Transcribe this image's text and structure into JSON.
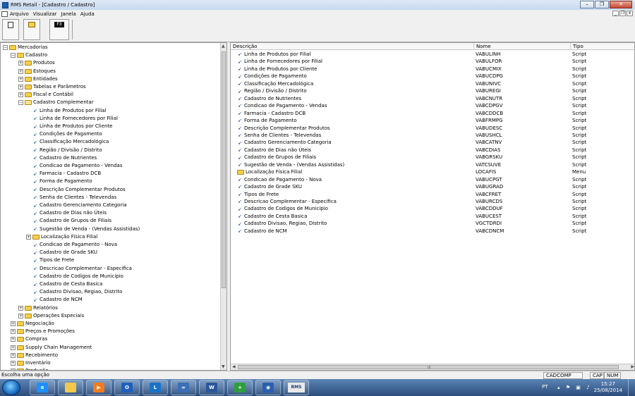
{
  "window": {
    "title": "RMS Retail - [Cadastro / Cadastro]",
    "minimize_glyph": "–",
    "restore_glyph": "❐",
    "close_glyph": "✕"
  },
  "menubar": {
    "items": [
      "Arquivo",
      "Visualizar",
      "Janela",
      "Ajuda"
    ],
    "mdi_min": "_",
    "mdi_restore": "❐",
    "mdi_close": "x"
  },
  "toolbar": {
    "new_icon": "document-icon",
    "open_icon": "folder-open-icon",
    "f3_label": "F3"
  },
  "tree": {
    "nodes": [
      {
        "label": "Mercadorias",
        "level": 0,
        "kind": "folder",
        "expander": "−"
      },
      {
        "label": "Cadastro",
        "level": 1,
        "kind": "folder",
        "expander": "−"
      },
      {
        "label": "Produtos",
        "level": 2,
        "kind": "folder",
        "expander": "+"
      },
      {
        "label": "Estoques",
        "level": 2,
        "kind": "folder",
        "expander": "+"
      },
      {
        "label": "Entidades",
        "level": 2,
        "kind": "folder",
        "expander": "+"
      },
      {
        "label": "Tabelas e Parâmetros",
        "level": 2,
        "kind": "folder",
        "expander": "+"
      },
      {
        "label": "Fiscal e Contábil",
        "level": 2,
        "kind": "folder",
        "expander": "+"
      },
      {
        "label": "Cadastro Complementar",
        "level": 2,
        "kind": "folder-open",
        "expander": "−"
      },
      {
        "label": "Linha de Produtos por Filial",
        "level": 3,
        "kind": "leaf"
      },
      {
        "label": "Linha de Fornecedores por Filial",
        "level": 3,
        "kind": "leaf"
      },
      {
        "label": "Linha de Produtos por Cliente",
        "level": 3,
        "kind": "leaf"
      },
      {
        "label": "Condições de Pagamento",
        "level": 3,
        "kind": "leaf"
      },
      {
        "label": "Classificação Mercadológica",
        "level": 3,
        "kind": "leaf"
      },
      {
        "label": "Região / Divisão / Distrito",
        "level": 3,
        "kind": "leaf"
      },
      {
        "label": "Cadastro de Nutrientes",
        "level": 3,
        "kind": "leaf"
      },
      {
        "label": "Condicao de Pagamento - Vendas",
        "level": 3,
        "kind": "leaf"
      },
      {
        "label": "Farmacia - Cadastro DCB",
        "level": 3,
        "kind": "leaf"
      },
      {
        "label": "Forma de Pagamento",
        "level": 3,
        "kind": "leaf"
      },
      {
        "label": "Descrição Complementar Produtos",
        "level": 3,
        "kind": "leaf"
      },
      {
        "label": "Senha de Clientes - Televendas",
        "level": 3,
        "kind": "leaf"
      },
      {
        "label": "Cadastro Gerenciamento Categoria",
        "level": 3,
        "kind": "leaf"
      },
      {
        "label": "Cadastro de Dias não Úteis",
        "level": 3,
        "kind": "leaf"
      },
      {
        "label": "Cadastro de Grupos de Filiais",
        "level": 3,
        "kind": "leaf"
      },
      {
        "label": "Sugestão de Venda - (Vendas Assistidas)",
        "level": 3,
        "kind": "leaf"
      },
      {
        "label": "Localização Física Filial",
        "level": 3,
        "kind": "folder",
        "expander": "+"
      },
      {
        "label": "Condicao de Pagamento - Nova",
        "level": 3,
        "kind": "leaf"
      },
      {
        "label": "Cadastro de Grade SKU",
        "level": 3,
        "kind": "leaf"
      },
      {
        "label": "Tipos de Frete",
        "level": 3,
        "kind": "leaf"
      },
      {
        "label": "Descricao Complementar - Especifica",
        "level": 3,
        "kind": "leaf"
      },
      {
        "label": "Cadastro de Codigos de Municipio",
        "level": 3,
        "kind": "leaf"
      },
      {
        "label": "Cadastro de Cesta Basica",
        "level": 3,
        "kind": "leaf"
      },
      {
        "label": "Cadastro Divisao, Regiao, Distrito",
        "level": 3,
        "kind": "leaf"
      },
      {
        "label": "Cadastro de NCM",
        "level": 3,
        "kind": "leaf"
      },
      {
        "label": "Relatórios",
        "level": 2,
        "kind": "folder",
        "expander": "+"
      },
      {
        "label": "Operações Especiais",
        "level": 2,
        "kind": "folder",
        "expander": "+"
      },
      {
        "label": "Negociação",
        "level": 1,
        "kind": "folder",
        "expander": "+"
      },
      {
        "label": "Preços e Promoções",
        "level": 1,
        "kind": "folder",
        "expander": "+"
      },
      {
        "label": "Compras",
        "level": 1,
        "kind": "folder",
        "expander": "+"
      },
      {
        "label": "Supply Chain Management",
        "level": 1,
        "kind": "folder",
        "expander": "+"
      },
      {
        "label": "Recebimento",
        "level": 1,
        "kind": "folder",
        "expander": "+"
      },
      {
        "label": "Inventário",
        "level": 1,
        "kind": "folder",
        "expander": "+"
      },
      {
        "label": "Produção",
        "level": 1,
        "kind": "folder",
        "expander": "+"
      }
    ]
  },
  "list": {
    "columns": [
      "Descrição",
      "Nome",
      "Tipo"
    ],
    "rows": [
      {
        "descricao": "Linha de Produtos por Filial",
        "nome": "VABULINH",
        "tipo": "Script",
        "icon": "script-icon"
      },
      {
        "descricao": "Linha de Fornecedores por Filial",
        "nome": "VABULFOR",
        "tipo": "Script",
        "icon": "script-icon"
      },
      {
        "descricao": "Linha de Produtos por Cliente",
        "nome": "VABUCMIX",
        "tipo": "Script",
        "icon": "script-icon"
      },
      {
        "descricao": "Condições de Pagamento",
        "nome": "VABUCDPG",
        "tipo": "Script",
        "icon": "script-icon"
      },
      {
        "descricao": "Classificação Mercadológica",
        "nome": "VABUNIVC",
        "tipo": "Script",
        "icon": "script-icon"
      },
      {
        "descricao": "Região / Divisão / Distrito",
        "nome": "VABUREGI",
        "tipo": "Script",
        "icon": "script-icon"
      },
      {
        "descricao": "Cadastro de Nutrientes",
        "nome": "VABCNUTR",
        "tipo": "Script",
        "icon": "script-icon"
      },
      {
        "descricao": "Condicao de Pagamento - Vendas",
        "nome": "VABCDPGV",
        "tipo": "Script",
        "icon": "script-icon"
      },
      {
        "descricao": "Farmacia - Cadastro DCB",
        "nome": "VABCDDCB",
        "tipo": "Script",
        "icon": "script-icon"
      },
      {
        "descricao": "Forma de Pagamento",
        "nome": "VABFRMPG",
        "tipo": "Script",
        "icon": "script-icon"
      },
      {
        "descricao": "Descrição Complementar Produtos",
        "nome": "VABUDESC",
        "tipo": "Script",
        "icon": "script-icon"
      },
      {
        "descricao": "Senha de Clientes - Televendas",
        "nome": "VABUSHCL",
        "tipo": "Script",
        "icon": "script-icon"
      },
      {
        "descricao": "Cadastro Gerenciamento Categoria",
        "nome": "VABCATNV",
        "tipo": "Script",
        "icon": "script-icon"
      },
      {
        "descricao": "Cadastro de Dias não Úteis",
        "nome": "VABCDIAS",
        "tipo": "Script",
        "icon": "script-icon"
      },
      {
        "descricao": "Cadastro de Grupos de Filiais",
        "nome": "VABGRSKU",
        "tipo": "Script",
        "icon": "script-icon"
      },
      {
        "descricao": "Sugestão de Venda - (Vendas Assistidas)",
        "nome": "VATCSUVE",
        "tipo": "Script",
        "icon": "script-icon"
      },
      {
        "descricao": "Localização Física Filial",
        "nome": "LOCAFIS",
        "tipo": "Menu",
        "icon": "folder-icon"
      },
      {
        "descricao": "Condicao de Pagamento - Nova",
        "nome": "VABUCPGT",
        "tipo": "Script",
        "icon": "script-icon"
      },
      {
        "descricao": "Cadastro de Grade SKU",
        "nome": "VABUGRAD",
        "tipo": "Script",
        "icon": "script-icon"
      },
      {
        "descricao": "Tipos de Frete",
        "nome": "VABCFRET",
        "tipo": "Script",
        "icon": "script-icon"
      },
      {
        "descricao": "Descricao Complementar - Especifica",
        "nome": "VABURCDS",
        "tipo": "Script",
        "icon": "script-icon"
      },
      {
        "descricao": "Cadastro de Codigos de Municipio",
        "nome": "VABCDDUF",
        "tipo": "Script",
        "icon": "script-icon"
      },
      {
        "descricao": "Cadastro de Cesta Basica",
        "nome": "VABUCEST",
        "tipo": "Script",
        "icon": "script-icon"
      },
      {
        "descricao": "Cadastro Divisao, Regiao, Distrito",
        "nome": "VGCTDRDI",
        "tipo": "Script",
        "icon": "script-icon"
      },
      {
        "descricao": "Cadastro de NCM",
        "nome": "VABCDNCM",
        "tipo": "Script",
        "icon": "script-icon"
      }
    ],
    "hscroll_grip": "III"
  },
  "statusbar": {
    "message": "Escolha uma opção",
    "panels": [
      "CADCOMP",
      "CAP",
      "NUM"
    ]
  },
  "taskbar": {
    "apps": [
      {
        "name": "ie-icon",
        "glyph": "e",
        "color": "#1e90ff"
      },
      {
        "name": "explorer-icon",
        "glyph": "",
        "color": "#f2c94c"
      },
      {
        "name": "media-player-icon",
        "glyph": "▶",
        "color": "#f07c1e"
      },
      {
        "name": "outlook-icon",
        "glyph": "O",
        "color": "#1f5fbf"
      },
      {
        "name": "lync-icon",
        "glyph": "L",
        "color": "#1a73c7"
      },
      {
        "name": "app-icon",
        "glyph": "∞",
        "color": "#3b6fb6"
      },
      {
        "name": "word-icon",
        "glyph": "W",
        "color": "#2b579a"
      },
      {
        "name": "health-app-icon",
        "glyph": "+",
        "color": "#2e9e3e"
      },
      {
        "name": "app-circle-icon",
        "glyph": "◉",
        "color": "#2a5fb0"
      },
      {
        "name": "rms-icon",
        "glyph": "RMS",
        "color": "#e9e9e9"
      }
    ],
    "language": "PT",
    "tray_icons": "▴ ⚑ ▣ ♪",
    "time": "15:27",
    "date": "25/08/2014"
  }
}
